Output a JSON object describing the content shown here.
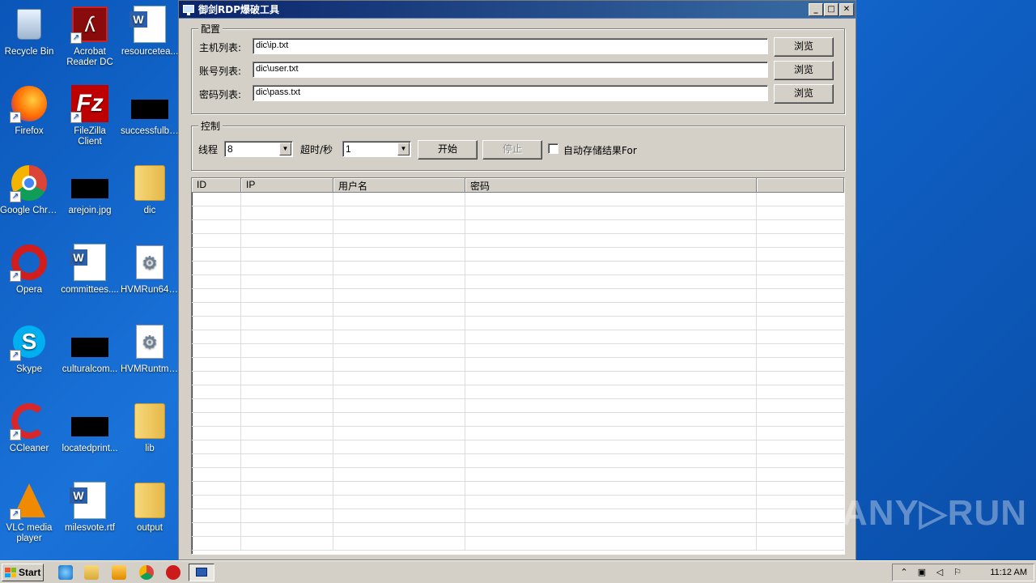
{
  "desktop": {
    "icons": [
      {
        "label": "Recycle Bin",
        "icon": "recycle-bin-icon"
      },
      {
        "label": "Acrobat Reader DC",
        "icon": "acrobat-icon"
      },
      {
        "label": "resourcetea...",
        "icon": "word-doc-icon"
      },
      {
        "label": "Firefox",
        "icon": "firefox-icon"
      },
      {
        "label": "FileZilla Client",
        "icon": "filezilla-icon"
      },
      {
        "label": "successfulbr...",
        "icon": "black-thumbnail-icon"
      },
      {
        "label": "Google Chrome",
        "icon": "chrome-icon"
      },
      {
        "label": "arejoin.jpg",
        "icon": "black-thumbnail-icon"
      },
      {
        "label": "dic",
        "icon": "folder-icon"
      },
      {
        "label": "Opera",
        "icon": "opera-icon"
      },
      {
        "label": "committees....",
        "icon": "word-doc-icon"
      },
      {
        "label": "HVMRun64.dll",
        "icon": "dll-gear-icon"
      },
      {
        "label": "Skype",
        "icon": "skype-icon"
      },
      {
        "label": "culturalcom...",
        "icon": "black-thumbnail-icon"
      },
      {
        "label": "HVMRuntm.dll",
        "icon": "dll-gear-icon"
      },
      {
        "label": "CCleaner",
        "icon": "ccleaner-icon"
      },
      {
        "label": "locatedprint...",
        "icon": "black-thumbnail-icon"
      },
      {
        "label": "lib",
        "icon": "folder-icon"
      },
      {
        "label": "VLC media player",
        "icon": "vlc-icon"
      },
      {
        "label": "milesvote.rtf",
        "icon": "word-doc-icon"
      },
      {
        "label": "output",
        "icon": "folder-icon"
      }
    ]
  },
  "window": {
    "title": "御剑RDP爆破工具",
    "buttons": {
      "minimize": "_",
      "maximize": "□",
      "close": "✕"
    },
    "config": {
      "group_label": "配置",
      "host_label": "主机列表:",
      "host_value": "dic\\ip.txt",
      "account_label": "账号列表:",
      "account_value": "dic\\user.txt",
      "password_label": "密码列表:",
      "password_value": "dic\\pass.txt",
      "browse_label": "浏览"
    },
    "control": {
      "group_label": "控制",
      "threads_label": "线程",
      "threads_value": "8",
      "timeout_label": "超时/秒",
      "timeout_value": "1",
      "start_label": "开始",
      "stop_label": "停止",
      "autosave_label": "自动存储结果For",
      "autosave_checked": false
    },
    "table": {
      "columns": [
        "ID",
        "IP",
        "用户名",
        "密码",
        ""
      ],
      "rows": []
    }
  },
  "taskbar": {
    "start_label": "Start",
    "clock": "11:12 AM"
  },
  "watermark": "ANY▷RUN"
}
